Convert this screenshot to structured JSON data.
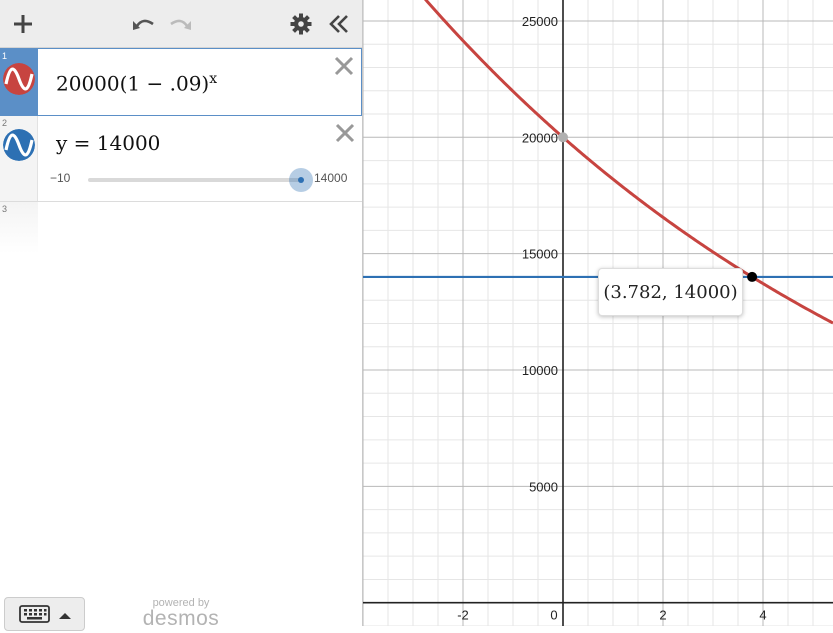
{
  "toolbar": {
    "icons": [
      "plus-icon",
      "undo-icon",
      "redo-icon",
      "gear-icon",
      "collapse-icon"
    ]
  },
  "expressions": [
    {
      "number": "1",
      "base": "20000(1 − .09)",
      "exponent": "x",
      "color": "#c74440"
    },
    {
      "number": "2",
      "latex": "y = 14000",
      "color": "#2d70b3",
      "slider": {
        "min": "−10",
        "max": "14000",
        "value": 14000
      }
    },
    {
      "number": "3"
    }
  ],
  "keyboard": {
    "icon": "keyboard-icon"
  },
  "branding": {
    "line1": "powered by",
    "line2": "desmos"
  },
  "graph": {
    "x_range": [
      -4.0,
      5.4
    ],
    "y_range": [
      -1000,
      25900
    ],
    "x_ticks": [
      "-2",
      "0",
      "2",
      "4"
    ],
    "y_ticks": [
      "5000",
      "10000",
      "15000",
      "20000",
      "25000"
    ],
    "curve_color": "#c74440",
    "line_color": "#2d70b3",
    "line_y": 14000,
    "intercept": {
      "x": 0,
      "y": 20000
    },
    "intersection": {
      "x": 3.782,
      "y": 14000
    },
    "tooltip": "(3.782, 14000)"
  }
}
